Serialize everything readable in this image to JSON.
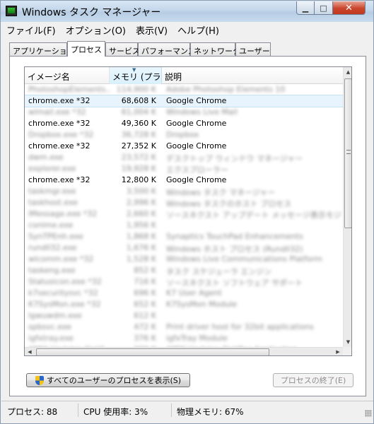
{
  "window": {
    "title": "Windows タスク マネージャー",
    "close_glyph": "✕",
    "max_glyph": "□",
    "min_glyph": "▁"
  },
  "menu": [
    "ファイル(F)",
    "オプション(O)",
    "表示(V)",
    "ヘルプ(H)"
  ],
  "tabs": [
    "アプリケーション",
    "プロセス",
    "サービス",
    "パフォーマンス",
    "ネットワーク",
    "ユーザー"
  ],
  "active_tab": "プロセス",
  "table": {
    "headers": [
      "イメージ名",
      "メモリ (プラ...",
      "説明"
    ],
    "sorted_column": "メモリ (プラ...",
    "rows": [
      {
        "name": "PhotoshopElements...",
        "mem": "114,900 K",
        "desc": "Adobe Photoshop Elements 10",
        "blurred": true
      },
      {
        "name": "chrome.exe *32",
        "mem": "68,608 K",
        "desc": "Google Chrome",
        "blurred": false,
        "selected": true
      },
      {
        "name": "wlmail.exe *32",
        "mem": "61,004 K",
        "desc": "Windows Live Mail",
        "blurred": true
      },
      {
        "name": "chrome.exe *32",
        "mem": "49,360 K",
        "desc": "Google Chrome",
        "blurred": false
      },
      {
        "name": "Dropbox.exe *32",
        "mem": "36,728 K",
        "desc": "Dropbox",
        "blurred": true
      },
      {
        "name": "chrome.exe *32",
        "mem": "27,352 K",
        "desc": "Google Chrome",
        "blurred": false
      },
      {
        "name": "dwm.exe",
        "mem": "23,572 K",
        "desc": "デスクトップ ウィンドウ マネージャー",
        "blurred": true
      },
      {
        "name": "explorer.exe",
        "mem": "19,928 K",
        "desc": "エクスプローラー",
        "blurred": true
      },
      {
        "name": "chrome.exe *32",
        "mem": "12,800 K",
        "desc": "Google Chrome",
        "blurred": false
      },
      {
        "name": "taskmgr.exe",
        "mem": "3,500 K",
        "desc": "Windows タスク マネージャー",
        "blurred": true
      },
      {
        "name": "taskhost.exe",
        "mem": "2,996 K",
        "desc": "Windows タスクのホスト プロセス",
        "blurred": true
      },
      {
        "name": "lMessage.exe *32",
        "mem": "2,660 K",
        "desc": "ソースネクスト アップデート メッセージ表示モジュ...",
        "blurred": true
      },
      {
        "name": "conime.exe",
        "mem": "1,956 K",
        "desc": "",
        "blurred": true
      },
      {
        "name": "SynTPEnh.exe",
        "mem": "1,868 K",
        "desc": "Synaptics TouchPad Enhancements",
        "blurred": true
      },
      {
        "name": "rundll32.exe",
        "mem": "1,676 K",
        "desc": "Windows ホスト プロセス (Rundll32)",
        "blurred": true
      },
      {
        "name": "wlcomm.exe *32",
        "mem": "1,528 K",
        "desc": "Windows Live Communications Platform",
        "blurred": true
      },
      {
        "name": "taskeng.exe",
        "mem": "852 K",
        "desc": "タスク スケジューラ エンジン",
        "blurred": true
      },
      {
        "name": "Statusicon.exe *32",
        "mem": "716 K",
        "desc": "ソースネクスト ソフトウェア サポート",
        "blurred": true
      },
      {
        "name": "k7securitysvc *32",
        "mem": "696 K",
        "desc": "K7 User Agent",
        "blurred": true
      },
      {
        "name": "K7SysMon.exe *32",
        "mem": "652 K",
        "desc": "K7SysMon Module",
        "blurred": true
      },
      {
        "name": "lgwuwdm.exe",
        "mem": "612 K",
        "desc": "",
        "blurred": true
      },
      {
        "name": "spbsvc.exe",
        "mem": "472 K",
        "desc": "Print driver host for 32bit applications",
        "blurred": true
      },
      {
        "name": "igfxtray.exe",
        "mem": "376 K",
        "desc": "igfxTray Module",
        "blurred": true
      },
      {
        "name": "AMW Updates Notif...",
        "mem": "300 K",
        "desc": "AMW Updates Notifier Application",
        "blurred": true
      }
    ]
  },
  "buttons": {
    "show_all": "すべてのユーザーのプロセスを表示(S)",
    "end_process": "プロセスの終了(E)"
  },
  "status": {
    "processes": "プロセス: 88",
    "cpu": "CPU 使用率: 3%",
    "memory": "物理メモリ: 67%"
  }
}
